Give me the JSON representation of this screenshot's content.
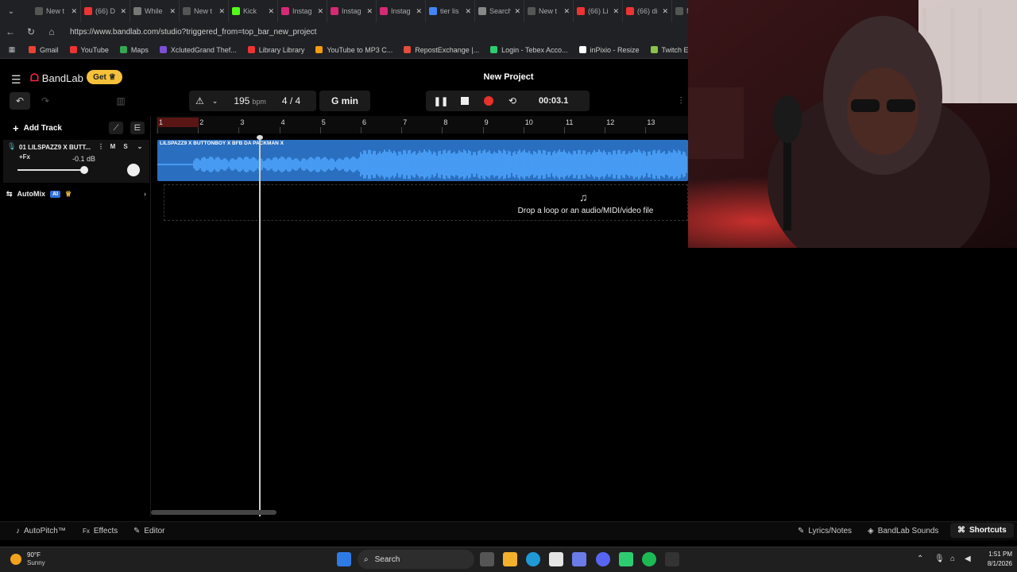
{
  "browser": {
    "tabs": [
      {
        "label": "New t",
        "color": "#555"
      },
      {
        "label": "(66) D",
        "color": "#e33"
      },
      {
        "label": "While",
        "color": "#777"
      },
      {
        "label": "New t",
        "color": "#555"
      },
      {
        "label": "Kick",
        "color": "#53fc18"
      },
      {
        "label": "Instag",
        "color": "#d62976"
      },
      {
        "label": "Instag",
        "color": "#d62976"
      },
      {
        "label": "Instag",
        "color": "#d62976"
      },
      {
        "label": "tier lis",
        "color": "#4285f4"
      },
      {
        "label": "Search",
        "color": "#888"
      },
      {
        "label": "New t",
        "color": "#555"
      },
      {
        "label": "(66) Li",
        "color": "#e33"
      },
      {
        "label": "(66) di",
        "color": "#e33"
      },
      {
        "label": "New",
        "color": "#555"
      }
    ],
    "url": "https://www.bandlab.com/studio?triggered_from=top_bar_new_project",
    "bookmarks": [
      {
        "label": "Gmail",
        "color": "#ea4335"
      },
      {
        "label": "YouTube",
        "color": "#e33"
      },
      {
        "label": "Maps",
        "color": "#34a853"
      },
      {
        "label": "XclutedGrand Thef...",
        "color": "#7b4fd6"
      },
      {
        "label": "Library Library",
        "color": "#e33"
      },
      {
        "label": "YouTube to MP3 C...",
        "color": "#f39c12"
      },
      {
        "label": "RepostExchange |...",
        "color": "#e74c3c"
      },
      {
        "label": "Login - Tebex Acco...",
        "color": "#2ecc71"
      },
      {
        "label": "inPixio - Resize",
        "color": "#fff"
      },
      {
        "label": "Twitch Emote Resiz...",
        "color": "#8bc34a"
      }
    ]
  },
  "app": {
    "logo": "BandLab",
    "get_label": "Get",
    "project_title": "New Project"
  },
  "toolbar": {
    "bpm": "195",
    "bpm_unit": "bpm",
    "time_signature": "4 / 4",
    "key": "G min",
    "time": "00:03.1"
  },
  "left_panel": {
    "add_track": "Add Track",
    "track": {
      "name": "01  LILSPAZZ9 X BUTT...",
      "mute": "M",
      "solo": "S",
      "fx": "+Fx",
      "volume_db": "-0.1 dB",
      "volume_level": 0.98
    },
    "automix": "AutoMix",
    "ai_badge": "AI"
  },
  "timeline": {
    "bars": [
      "1",
      "2",
      "3",
      "4",
      "5",
      "6",
      "7",
      "8",
      "9",
      "10",
      "11",
      "12",
      "13"
    ],
    "clip_title": "LILSPAZZ9 X BUTTONBOY X BFB DA PACKMAN X",
    "drop_text": "Drop a loop or an audio/MIDI/video file"
  },
  "bottom_bar": {
    "autopitch": "AutoPitch™",
    "effects": "Effects",
    "editor": "Editor",
    "lyrics": "Lyrics/Notes",
    "sounds": "BandLab Sounds",
    "shortcuts": "Shortcuts"
  },
  "taskbar": {
    "temperature": "90°F",
    "weather": "Sunny",
    "search": "Search",
    "time": "1:51 PM",
    "date": "8/1/2026"
  },
  "colors": {
    "accent": "#f6c13a",
    "clip": "#2a6fbf",
    "record": "#e6322a"
  }
}
